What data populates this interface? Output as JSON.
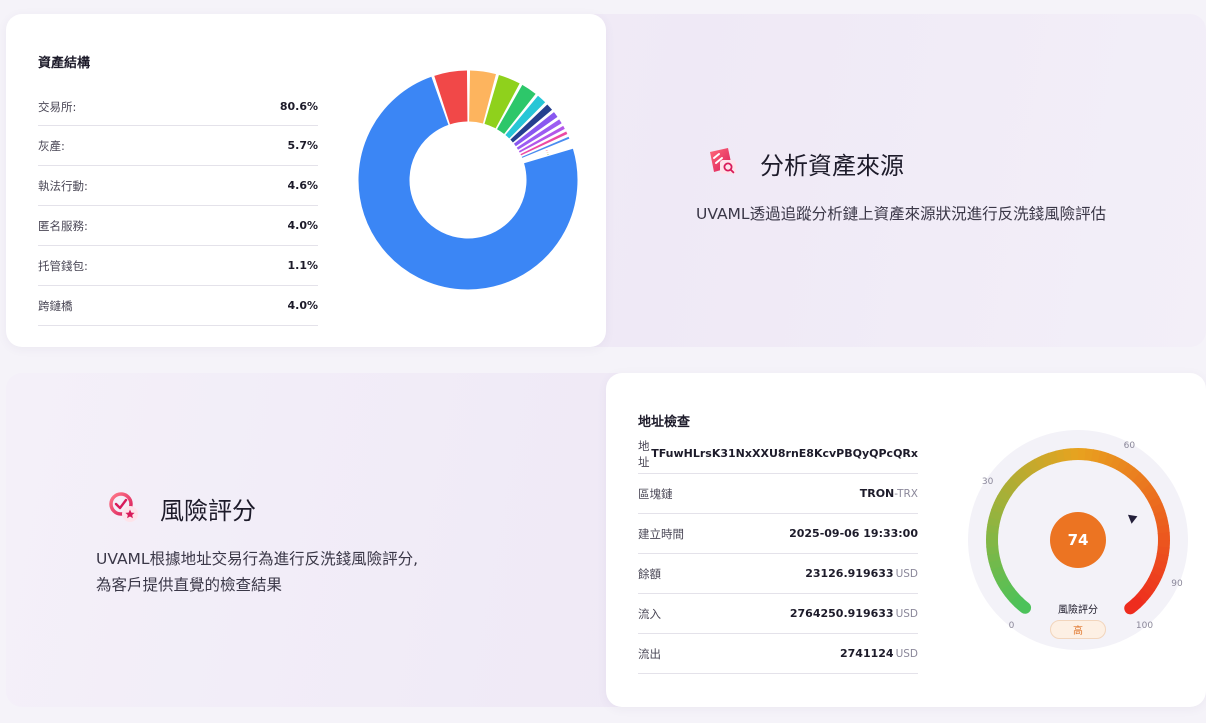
{
  "asset_structure": {
    "title": "資產結構",
    "rows": [
      {
        "label": "交易所:",
        "value": "80.6%"
      },
      {
        "label": "灰產:",
        "value": "5.7%"
      },
      {
        "label": "執法行動:",
        "value": "4.6%"
      },
      {
        "label": "匿名服務:",
        "value": "4.0%"
      },
      {
        "label": "托管錢包:",
        "value": "1.1%"
      },
      {
        "label": "跨鏈橋",
        "value": "4.0%"
      }
    ]
  },
  "chart_data": {
    "type": "pie",
    "title": "",
    "segments": [
      {
        "value": 80.6,
        "color": "#3b86f5"
      },
      {
        "value": 5.7,
        "color": "#f14848"
      },
      {
        "value": 4.6,
        "color": "#fdb45e"
      },
      {
        "value": 4.0,
        "color": "#8fd11c"
      },
      {
        "value": 3.0,
        "color": "#2dc76a"
      },
      {
        "value": 2.0,
        "color": "#27c6d6"
      },
      {
        "value": 1.6,
        "color": "#253f8f"
      },
      {
        "value": 1.4,
        "color": "#8957f0"
      },
      {
        "value": 1.2,
        "color": "#9c5cf2"
      },
      {
        "value": 1.0,
        "color": "#b257e9"
      },
      {
        "value": 0.9,
        "color": "#ec4aa3"
      },
      {
        "value": 0.8,
        "color": "#4a8cf0"
      },
      {
        "value": 0.45,
        "color": "#f3617e"
      },
      {
        "value": 0.4,
        "color": "#f5a052"
      },
      {
        "value": 0.35,
        "color": "#8fd11c"
      }
    ]
  },
  "feature_source": {
    "title": "分析資產來源",
    "description": "UVAML透過追蹤分析鏈上資產來源狀況進行反洗錢風險評估",
    "icon": "search-document-icon"
  },
  "feature_risk": {
    "title": "風險評分",
    "description_line1": "UVAML根據地址交易行為進行反洗錢風險評分,",
    "description_line2": "為客戶提供直覺的檢查結果",
    "icon": "badge-star-icon"
  },
  "address_check": {
    "title": "地址檢查",
    "rows": [
      {
        "label": "地址",
        "value": "TFuwHLrsK31NxXXU8rnE8KcvPBQyQPcQRx",
        "unit": ""
      },
      {
        "label": "區塊鏈",
        "value": "TRON",
        "unit": "-TRX"
      },
      {
        "label": "建立時間",
        "value": "2025-09-06 19:33:00",
        "unit": ""
      },
      {
        "label": "餘額",
        "value": "23126.919633",
        "unit": "USD"
      },
      {
        "label": "流入",
        "value": "2764250.919633",
        "unit": "USD"
      },
      {
        "label": "流出",
        "value": "2741124",
        "unit": "USD"
      }
    ]
  },
  "risk_gauge": {
    "score": 74,
    "score_text": "74",
    "max": 100,
    "ticks": [
      "0",
      "30",
      "60",
      "90",
      "100"
    ],
    "label": "風險評分",
    "level": "高",
    "colors": {
      "low": "#4cc25a",
      "mid": "#e8a21f",
      "high": "#ee2c1e",
      "value": "#ec7422"
    }
  }
}
